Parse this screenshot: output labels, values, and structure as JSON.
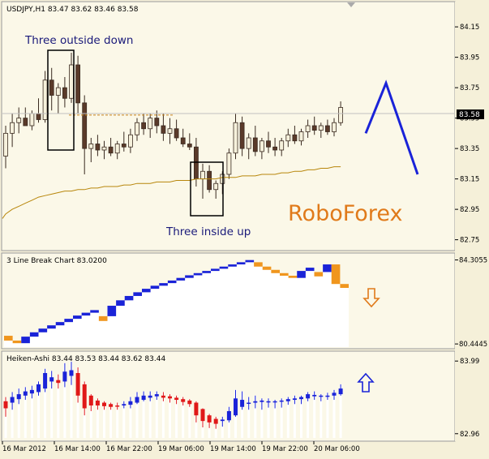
{
  "colors": {
    "background": "#f5f0d9",
    "plot_bg": "#fbf8e8",
    "border": "#9a9a9a",
    "bull_candle": "#f6f1dc",
    "bear_candle": "#5a3a2a",
    "wick": "#3a2a20",
    "ma_line": "#b8860b",
    "dotted_level": "#c8841a",
    "current_price_line": "#c0c0c0",
    "three_line_up": "#1a23d8",
    "three_line_down": "#f0961e",
    "ha_up": "#1a23d8",
    "ha_down": "#e01818",
    "forecast_line": "#1a23d8",
    "brand_text": "#e07a1a",
    "arrow_down": "#e07a1a",
    "arrow_up": "#1a23d8",
    "annotation_text": "#1a1a7a"
  },
  "main_header": "USDJPY,H1  83.47 83.62 83.46 83.58",
  "current_price_label": "83.58",
  "brand": "RoboForex",
  "annotations": {
    "outside_down": "Three outside down",
    "inside_up": "Three inside up"
  },
  "three_line_header": "3 Line Break Chart 83.0200",
  "heiken_header": "Heiken-Ashi 83.44 83.53 83.44 83.62 83.44",
  "chart_data": [
    {
      "type": "candlestick",
      "title": "USDJPY,H1",
      "ylim": [
        82.7,
        84.22
      ],
      "y_ticks": [
        "84.15",
        "83.95",
        "83.75",
        "83.55",
        "83.35",
        "83.15",
        "82.95",
        "82.75"
      ],
      "ohlc": [
        {
          "o": 83.3,
          "h": 83.5,
          "l": 83.22,
          "c": 83.45
        },
        {
          "o": 83.45,
          "h": 83.58,
          "l": 83.36,
          "c": 83.52
        },
        {
          "o": 83.52,
          "h": 83.62,
          "l": 83.45,
          "c": 83.55
        },
        {
          "o": 83.55,
          "h": 83.62,
          "l": 83.5,
          "c": 83.5
        },
        {
          "o": 83.5,
          "h": 83.6,
          "l": 83.47,
          "c": 83.58
        },
        {
          "o": 83.58,
          "h": 83.68,
          "l": 83.52,
          "c": 83.54
        },
        {
          "o": 83.54,
          "h": 83.86,
          "l": 83.52,
          "c": 83.8
        },
        {
          "o": 83.8,
          "h": 83.88,
          "l": 83.6,
          "c": 83.7
        },
        {
          "o": 83.7,
          "h": 83.78,
          "l": 83.58,
          "c": 83.75
        },
        {
          "o": 83.75,
          "h": 83.82,
          "l": 83.62,
          "c": 83.68
        },
        {
          "o": 83.68,
          "h": 83.98,
          "l": 83.65,
          "c": 83.9
        },
        {
          "o": 83.9,
          "h": 83.96,
          "l": 83.58,
          "c": 83.65
        },
        {
          "o": 83.65,
          "h": 83.7,
          "l": 83.18,
          "c": 83.35
        },
        {
          "o": 83.35,
          "h": 83.42,
          "l": 83.26,
          "c": 83.38
        },
        {
          "o": 83.38,
          "h": 83.44,
          "l": 83.3,
          "c": 83.34
        },
        {
          "o": 83.34,
          "h": 83.4,
          "l": 83.28,
          "c": 83.36
        },
        {
          "o": 83.36,
          "h": 83.42,
          "l": 83.3,
          "c": 83.32
        },
        {
          "o": 83.32,
          "h": 83.4,
          "l": 83.28,
          "c": 83.38
        },
        {
          "o": 83.38,
          "h": 83.46,
          "l": 83.33,
          "c": 83.36
        },
        {
          "o": 83.36,
          "h": 83.48,
          "l": 83.32,
          "c": 83.44
        },
        {
          "o": 83.44,
          "h": 83.55,
          "l": 83.4,
          "c": 83.52
        },
        {
          "o": 83.52,
          "h": 83.58,
          "l": 83.44,
          "c": 83.48
        },
        {
          "o": 83.48,
          "h": 83.58,
          "l": 83.42,
          "c": 83.55
        },
        {
          "o": 83.55,
          "h": 83.6,
          "l": 83.45,
          "c": 83.5
        },
        {
          "o": 83.5,
          "h": 83.58,
          "l": 83.4,
          "c": 83.45
        },
        {
          "o": 83.45,
          "h": 83.55,
          "l": 83.38,
          "c": 83.48
        },
        {
          "o": 83.48,
          "h": 83.54,
          "l": 83.4,
          "c": 83.42
        },
        {
          "o": 83.42,
          "h": 83.48,
          "l": 83.36,
          "c": 83.38
        },
        {
          "o": 83.38,
          "h": 83.45,
          "l": 83.34,
          "c": 83.36
        },
        {
          "o": 83.36,
          "h": 83.42,
          "l": 83.1,
          "c": 83.15
        },
        {
          "o": 83.15,
          "h": 83.25,
          "l": 83.02,
          "c": 83.2
        },
        {
          "o": 83.2,
          "h": 83.24,
          "l": 83.06,
          "c": 83.08
        },
        {
          "o": 83.08,
          "h": 83.14,
          "l": 83.02,
          "c": 83.12
        },
        {
          "o": 83.12,
          "h": 83.2,
          "l": 83.05,
          "c": 83.18
        },
        {
          "o": 83.18,
          "h": 83.35,
          "l": 83.15,
          "c": 83.32
        },
        {
          "o": 83.32,
          "h": 83.58,
          "l": 83.28,
          "c": 83.52
        },
        {
          "o": 83.52,
          "h": 83.56,
          "l": 83.3,
          "c": 83.35
        },
        {
          "o": 83.35,
          "h": 83.45,
          "l": 83.28,
          "c": 83.42
        },
        {
          "o": 83.42,
          "h": 83.5,
          "l": 83.3,
          "c": 83.33
        },
        {
          "o": 83.33,
          "h": 83.42,
          "l": 83.28,
          "c": 83.4
        },
        {
          "o": 83.4,
          "h": 83.46,
          "l": 83.32,
          "c": 83.36
        },
        {
          "o": 83.36,
          "h": 83.42,
          "l": 83.3,
          "c": 83.34
        },
        {
          "o": 83.34,
          "h": 83.42,
          "l": 83.3,
          "c": 83.4
        },
        {
          "o": 83.4,
          "h": 83.48,
          "l": 83.36,
          "c": 83.44
        },
        {
          "o": 83.44,
          "h": 83.5,
          "l": 83.38,
          "c": 83.4
        },
        {
          "o": 83.4,
          "h": 83.48,
          "l": 83.37,
          "c": 83.46
        },
        {
          "o": 83.46,
          "h": 83.54,
          "l": 83.42,
          "c": 83.5
        },
        {
          "o": 83.5,
          "h": 83.56,
          "l": 83.44,
          "c": 83.47
        },
        {
          "o": 83.47,
          "h": 83.52,
          "l": 83.42,
          "c": 83.5
        },
        {
          "o": 83.5,
          "h": 83.54,
          "l": 83.44,
          "c": 83.46
        },
        {
          "o": 83.46,
          "h": 83.55,
          "l": 83.43,
          "c": 83.52
        },
        {
          "o": 83.52,
          "h": 83.66,
          "l": 83.5,
          "c": 83.62
        }
      ],
      "moving_average": [
        82.92,
        82.95,
        82.97,
        82.99,
        83.01,
        83.03,
        83.04,
        83.05,
        83.06,
        83.07,
        83.07,
        83.08,
        83.08,
        83.09,
        83.09,
        83.1,
        83.1,
        83.1,
        83.11,
        83.11,
        83.12,
        83.12,
        83.12,
        83.13,
        83.13,
        83.13,
        83.14,
        83.14,
        83.14,
        83.15,
        83.15,
        83.15,
        83.15,
        83.16,
        83.16,
        83.16,
        83.17,
        83.17,
        83.17,
        83.18,
        83.18,
        83.18,
        83.19,
        83.19,
        83.2,
        83.2,
        83.21,
        83.21,
        83.22,
        83.22,
        83.23,
        83.23
      ],
      "level_line": 83.57,
      "current_price": 83.58,
      "forecast_zigzag": [
        83.45,
        83.78,
        83.18
      ]
    },
    {
      "type": "line_break",
      "title": "3 Line Break Chart 83.0200",
      "ylim": [
        80.3,
        84.4
      ],
      "y_ticks": [
        "84.3055",
        "80.4445"
      ],
      "blocks": [
        {
          "low": 80.6,
          "high": 80.82,
          "dir": "down"
        },
        {
          "low": 80.48,
          "high": 80.6,
          "dir": "down"
        },
        {
          "low": 80.48,
          "high": 80.78,
          "dir": "up"
        },
        {
          "low": 80.78,
          "high": 80.98,
          "dir": "up"
        },
        {
          "low": 80.98,
          "high": 81.15,
          "dir": "up"
        },
        {
          "low": 81.15,
          "high": 81.3,
          "dir": "up"
        },
        {
          "low": 81.3,
          "high": 81.45,
          "dir": "up"
        },
        {
          "low": 81.45,
          "high": 81.6,
          "dir": "up"
        },
        {
          "low": 81.6,
          "high": 81.75,
          "dir": "up"
        },
        {
          "low": 81.75,
          "high": 81.88,
          "dir": "up"
        },
        {
          "low": 81.88,
          "high": 82.0,
          "dir": "up"
        },
        {
          "low": 81.5,
          "high": 81.72,
          "dir": "down"
        },
        {
          "low": 81.72,
          "high": 82.2,
          "dir": "up"
        },
        {
          "low": 82.2,
          "high": 82.45,
          "dir": "up"
        },
        {
          "low": 82.45,
          "high": 82.65,
          "dir": "up"
        },
        {
          "low": 82.65,
          "high": 82.82,
          "dir": "up"
        },
        {
          "low": 82.82,
          "high": 82.98,
          "dir": "up"
        },
        {
          "low": 82.98,
          "high": 83.12,
          "dir": "up"
        },
        {
          "low": 83.12,
          "high": 83.24,
          "dir": "up"
        },
        {
          "low": 83.24,
          "high": 83.36,
          "dir": "up"
        },
        {
          "low": 83.36,
          "high": 83.48,
          "dir": "up"
        },
        {
          "low": 83.48,
          "high": 83.6,
          "dir": "up"
        },
        {
          "low": 83.6,
          "high": 83.7,
          "dir": "up"
        },
        {
          "low": 83.7,
          "high": 83.8,
          "dir": "up"
        },
        {
          "low": 83.8,
          "high": 83.9,
          "dir": "up"
        },
        {
          "low": 83.9,
          "high": 84.0,
          "dir": "up"
        },
        {
          "low": 84.0,
          "high": 84.1,
          "dir": "up"
        },
        {
          "low": 84.1,
          "high": 84.2,
          "dir": "up"
        },
        {
          "low": 84.2,
          "high": 84.3,
          "dir": "up"
        },
        {
          "low": 84.0,
          "high": 84.2,
          "dir": "down"
        },
        {
          "low": 83.85,
          "high": 84.0,
          "dir": "down"
        },
        {
          "low": 83.7,
          "high": 83.85,
          "dir": "down"
        },
        {
          "low": 83.58,
          "high": 83.7,
          "dir": "down"
        },
        {
          "low": 83.48,
          "high": 83.58,
          "dir": "down"
        },
        {
          "low": 83.48,
          "high": 83.8,
          "dir": "up"
        },
        {
          "low": 83.8,
          "high": 83.95,
          "dir": "up"
        },
        {
          "low": 83.55,
          "high": 83.75,
          "dir": "down"
        },
        {
          "low": 83.75,
          "high": 84.1,
          "dir": "up"
        },
        {
          "low": 83.2,
          "high": 84.1,
          "dir": "down"
        },
        {
          "low": 83.02,
          "high": 83.2,
          "dir": "down"
        }
      ]
    },
    {
      "type": "heiken_ashi",
      "title": "Heiken-Ashi 83.44 83.53 83.44 83.62 83.44",
      "ylim": [
        82.9,
        84.05
      ],
      "y_ticks": [
        "83.99",
        "82.96"
      ],
      "bars": [
        {
          "o": 83.32,
          "h": 83.48,
          "l": 83.2,
          "c": 83.42,
          "dir": "down"
        },
        {
          "o": 83.4,
          "h": 83.55,
          "l": 83.3,
          "c": 83.48,
          "dir": "up"
        },
        {
          "o": 83.45,
          "h": 83.6,
          "l": 83.38,
          "c": 83.52,
          "dir": "up"
        },
        {
          "o": 83.5,
          "h": 83.62,
          "l": 83.44,
          "c": 83.56,
          "dir": "up"
        },
        {
          "o": 83.53,
          "h": 83.64,
          "l": 83.46,
          "c": 83.58,
          "dir": "up"
        },
        {
          "o": 83.55,
          "h": 83.7,
          "l": 83.5,
          "c": 83.66,
          "dir": "up"
        },
        {
          "o": 83.6,
          "h": 83.88,
          "l": 83.55,
          "c": 83.82,
          "dir": "up"
        },
        {
          "o": 83.7,
          "h": 83.85,
          "l": 83.6,
          "c": 83.76,
          "dir": "up"
        },
        {
          "o": 83.72,
          "h": 83.8,
          "l": 83.6,
          "c": 83.68,
          "dir": "down"
        },
        {
          "o": 83.7,
          "h": 83.96,
          "l": 83.62,
          "c": 83.84,
          "dir": "up"
        },
        {
          "o": 83.78,
          "h": 83.98,
          "l": 83.65,
          "c": 83.86,
          "dir": "up"
        },
        {
          "o": 83.82,
          "h": 83.9,
          "l": 83.4,
          "c": 83.5,
          "dir": "down"
        },
        {
          "o": 83.66,
          "h": 83.7,
          "l": 83.22,
          "c": 83.32,
          "dir": "down"
        },
        {
          "o": 83.5,
          "h": 83.52,
          "l": 83.28,
          "c": 83.36,
          "dir": "down"
        },
        {
          "o": 83.43,
          "h": 83.46,
          "l": 83.3,
          "c": 83.36,
          "dir": "down"
        },
        {
          "o": 83.4,
          "h": 83.42,
          "l": 83.3,
          "c": 83.35,
          "dir": "down"
        },
        {
          "o": 83.38,
          "h": 83.4,
          "l": 83.3,
          "c": 83.34,
          "dir": "down"
        },
        {
          "o": 83.36,
          "h": 83.4,
          "l": 83.3,
          "c": 83.35,
          "dir": "down"
        },
        {
          "o": 83.36,
          "h": 83.42,
          "l": 83.32,
          "c": 83.38,
          "dir": "up"
        },
        {
          "o": 83.37,
          "h": 83.48,
          "l": 83.32,
          "c": 83.42,
          "dir": "up"
        },
        {
          "o": 83.4,
          "h": 83.55,
          "l": 83.38,
          "c": 83.48,
          "dir": "up"
        },
        {
          "o": 83.44,
          "h": 83.56,
          "l": 83.42,
          "c": 83.5,
          "dir": "up"
        },
        {
          "o": 83.47,
          "h": 83.56,
          "l": 83.42,
          "c": 83.5,
          "dir": "up"
        },
        {
          "o": 83.49,
          "h": 83.56,
          "l": 83.44,
          "c": 83.52,
          "dir": "up"
        },
        {
          "o": 83.5,
          "h": 83.55,
          "l": 83.42,
          "c": 83.47,
          "dir": "down"
        },
        {
          "o": 83.49,
          "h": 83.52,
          "l": 83.4,
          "c": 83.46,
          "dir": "down"
        },
        {
          "o": 83.47,
          "h": 83.5,
          "l": 83.38,
          "c": 83.44,
          "dir": "down"
        },
        {
          "o": 83.45,
          "h": 83.48,
          "l": 83.36,
          "c": 83.41,
          "dir": "down"
        },
        {
          "o": 83.43,
          "h": 83.45,
          "l": 83.34,
          "c": 83.38,
          "dir": "down"
        },
        {
          "o": 83.4,
          "h": 83.42,
          "l": 83.12,
          "c": 83.22,
          "dir": "down"
        },
        {
          "o": 83.31,
          "h": 83.32,
          "l": 83.05,
          "c": 83.14,
          "dir": "down"
        },
        {
          "o": 83.22,
          "h": 83.24,
          "l": 83.04,
          "c": 83.12,
          "dir": "down"
        },
        {
          "o": 83.17,
          "h": 83.2,
          "l": 83.03,
          "c": 83.1,
          "dir": "down"
        },
        {
          "o": 83.14,
          "h": 83.2,
          "l": 83.06,
          "c": 83.16,
          "dir": "up"
        },
        {
          "o": 83.15,
          "h": 83.34,
          "l": 83.12,
          "c": 83.28,
          "dir": "up"
        },
        {
          "o": 83.22,
          "h": 83.58,
          "l": 83.2,
          "c": 83.46,
          "dir": "up"
        },
        {
          "o": 83.34,
          "h": 83.56,
          "l": 83.3,
          "c": 83.44,
          "dir": "up"
        },
        {
          "o": 83.39,
          "h": 83.48,
          "l": 83.3,
          "c": 83.4,
          "dir": "up"
        },
        {
          "o": 83.4,
          "h": 83.5,
          "l": 83.32,
          "c": 83.42,
          "dir": "up"
        },
        {
          "o": 83.41,
          "h": 83.46,
          "l": 83.3,
          "c": 83.43,
          "dir": "up"
        },
        {
          "o": 83.42,
          "h": 83.46,
          "l": 83.33,
          "c": 83.42,
          "dir": "up"
        },
        {
          "o": 83.42,
          "h": 83.44,
          "l": 83.32,
          "c": 83.42,
          "dir": "up"
        },
        {
          "o": 83.42,
          "h": 83.46,
          "l": 83.33,
          "c": 83.43,
          "dir": "up"
        },
        {
          "o": 83.42,
          "h": 83.48,
          "l": 83.37,
          "c": 83.45,
          "dir": "up"
        },
        {
          "o": 83.44,
          "h": 83.5,
          "l": 83.38,
          "c": 83.46,
          "dir": "up"
        },
        {
          "o": 83.45,
          "h": 83.5,
          "l": 83.38,
          "c": 83.48,
          "dir": "up"
        },
        {
          "o": 83.46,
          "h": 83.55,
          "l": 83.42,
          "c": 83.52,
          "dir": "up"
        },
        {
          "o": 83.49,
          "h": 83.56,
          "l": 83.44,
          "c": 83.51,
          "dir": "up"
        },
        {
          "o": 83.5,
          "h": 83.52,
          "l": 83.42,
          "c": 83.5,
          "dir": "up"
        },
        {
          "o": 83.5,
          "h": 83.54,
          "l": 83.44,
          "c": 83.5,
          "dir": "up"
        },
        {
          "o": 83.5,
          "h": 83.58,
          "l": 83.44,
          "c": 83.54,
          "dir": "up"
        },
        {
          "o": 83.52,
          "h": 83.66,
          "l": 83.5,
          "c": 83.6,
          "dir": "up"
        }
      ]
    }
  ],
  "x_axis": {
    "labels": [
      "16 Mar 2012",
      "16 Mar 14:00",
      "16 Mar 22:00",
      "19 Mar 06:00",
      "19 Mar 14:00",
      "19 Mar 22:00",
      "20 Mar 06:00"
    ]
  }
}
